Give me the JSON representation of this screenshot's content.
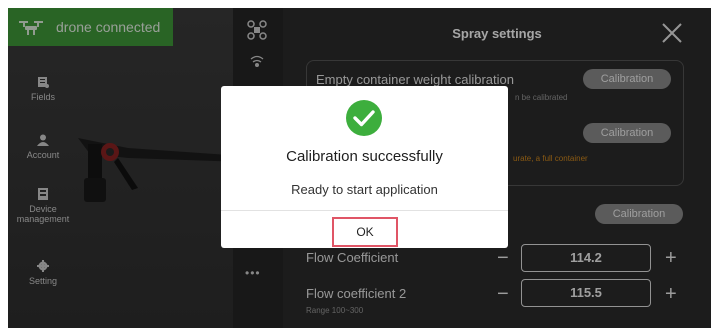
{
  "status": {
    "label": "drone connected"
  },
  "sidebar": {
    "items": [
      {
        "label": "Fields"
      },
      {
        "label": "Account"
      },
      {
        "label_line1": "Device",
        "label_line2": "management"
      },
      {
        "label": "Setting"
      }
    ]
  },
  "toolstrip": {
    "more_label": "•••"
  },
  "panel": {
    "title": "Spray settings",
    "empty_container": {
      "label": "Empty container weight calibration",
      "note": "n be calibrated",
      "button": "Calibration"
    },
    "full_container": {
      "note": "urate, a full container",
      "button": "Calibration"
    },
    "third": {
      "button": "Calibration"
    },
    "flow_coefficient": {
      "label": "Flow Coefficient",
      "value": "114.2",
      "minus": "−",
      "plus": "+"
    },
    "flow_coefficient_2": {
      "label": "Flow coefficient 2",
      "value": "115.5",
      "range": "Range 100~300",
      "minus": "−",
      "plus": "+"
    }
  },
  "dialog": {
    "title": "Calibration successfully",
    "message": "Ready to start application",
    "ok_label": "OK"
  },
  "colors": {
    "status_green": "#3f9a3a",
    "success_green": "#3dae3d",
    "highlight_red": "#e05566",
    "note_orange": "#d48a1e",
    "note_gray": "#9a9a9a"
  },
  "icons": [
    "drone-icon",
    "fields-icon",
    "account-icon",
    "device-management-icon",
    "setting-icon",
    "drone-tool-icon",
    "signal-icon",
    "close-icon",
    "check-icon"
  ]
}
